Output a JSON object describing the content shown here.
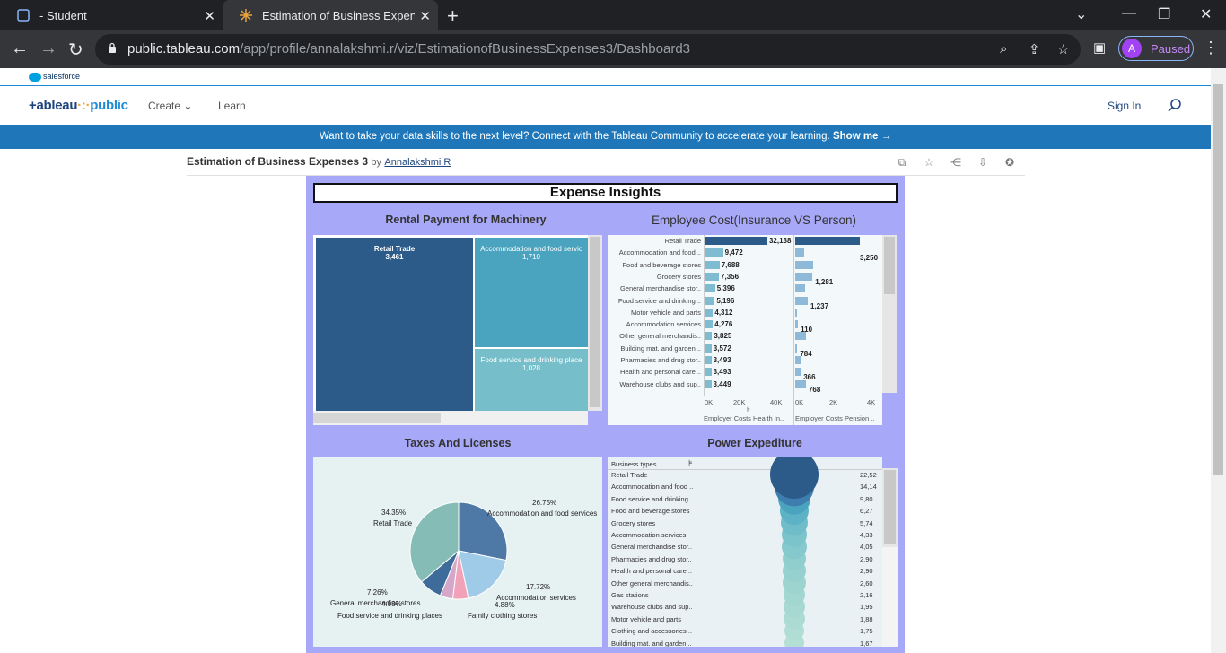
{
  "browser": {
    "tabs": [
      {
        "title": "- Student",
        "active": false
      },
      {
        "title": "Estimation of Business Expenses",
        "active": true
      }
    ],
    "url_host": "public.tableau.com",
    "url_path": "/app/profile/annalakshmi.r/viz/EstimationofBusinessExpenses3/Dashboard3",
    "profile_initial": "A",
    "profile_status": "Paused"
  },
  "salesforce_label": "salesforce",
  "header": {
    "logo_main": "+ableau",
    "logo_sub": "public",
    "nav": [
      "Create",
      "Learn"
    ],
    "signin": "Sign In"
  },
  "banner": {
    "text": "Want to take your data skills to the next level? Connect with the Tableau Community to accelerate your learning.",
    "cta": "Show me →"
  },
  "viz": {
    "title": "Estimation of Business Expenses 3",
    "by": "by",
    "author": "Annalakshmi R"
  },
  "dashboard": {
    "title": "Expense Insights",
    "rental_title": "Rental Payment for Machinery",
    "employee_title": "Employee Cost(Insurance VS Person)",
    "taxes_title": "Taxes And Licenses",
    "power_title": "Power Expediture"
  },
  "treemap": [
    {
      "label": "Retail Trade",
      "value": "3,461",
      "color": "#2c5b8a"
    },
    {
      "label": "Accommodation and food servic",
      "value": "1,710",
      "color": "#4aa4bf"
    },
    {
      "label": "Food service and drinking place",
      "value": "1,028",
      "color": "#76bfca"
    }
  ],
  "employee_chart": {
    "categories": [
      "Retail Trade",
      "Accommodation and food ..",
      "Food and beverage stores",
      "Grocery stores",
      "General merchandise stor..",
      "Food service and drinking ..",
      "Motor vehicle and parts",
      "Accommodation services",
      "Other general merchandis..",
      "Building mat. and garden ..",
      "Pharmacies and drug stor..",
      "Health and personal care ..",
      "Warehouse clubs and sup.."
    ],
    "health_values": [
      32138,
      9472,
      7688,
      7356,
      5396,
      5196,
      4312,
      4276,
      3825,
      3572,
      3493,
      3493,
      3449
    ],
    "health_labels": [
      "32,138",
      "9,472",
      "7,688",
      "7,356",
      "5,396",
      "5,196",
      "4,312",
      "4,276",
      "3,825",
      "3,572",
      "3,493",
      "3,493",
      "3,449"
    ],
    "pension_values": [
      4600,
      650,
      1281,
      1237,
      700,
      900,
      110,
      200,
      784,
      150,
      366,
      400,
      768
    ],
    "pension_labels": [
      "",
      "3,250",
      "",
      "1,281",
      "",
      "1,237",
      "",
      "110",
      "",
      "784",
      "",
      "366",
      "768"
    ],
    "health_ticks": [
      "0K",
      "20K",
      "40K"
    ],
    "pension_ticks": [
      "0K",
      "2K",
      "4K"
    ],
    "health_axis": "Employer Costs Health In..",
    "pension_axis": "Employer Costs Pension ..",
    "health_color": "#2c5b8a",
    "light_color": "#7fbcd2"
  },
  "pie": {
    "slices": [
      {
        "label": "Accommodation and food services",
        "pct": "26.75%",
        "value": 26.75,
        "color": "#4e79a7"
      },
      {
        "label": "Accommodation services",
        "pct": "17.72%",
        "value": 17.72,
        "color": "#a0cbe8"
      },
      {
        "label": "Family clothing stores",
        "pct": "4.88%",
        "value": 4.88,
        "color": "#f1a2b9"
      },
      {
        "label": "Food service and drinking places",
        "pct": "4.08%",
        "value": 4.08,
        "color": "#d4a6c8"
      },
      {
        "label": "General merchandise stores",
        "pct": "7.26%",
        "value": 7.26,
        "color": "#3d6b9a"
      },
      {
        "label": "Retail Trade",
        "pct": "34.35%",
        "value": 34.35,
        "color": "#86bcb6"
      }
    ]
  },
  "power": {
    "header": "Business types",
    "rows": [
      {
        "name": "Retail Trade",
        "value": "22,52"
      },
      {
        "name": "Accommodation and food ..",
        "value": "14,14"
      },
      {
        "name": "Food service and drinking ..",
        "value": "9,80"
      },
      {
        "name": "Food and beverage stores",
        "value": "6,27"
      },
      {
        "name": "Grocery stores",
        "value": "5,74"
      },
      {
        "name": "Accommodation services",
        "value": "4,33"
      },
      {
        "name": "General merchandise stor..",
        "value": "4,05"
      },
      {
        "name": "Pharmacies and drug stor..",
        "value": "2,90"
      },
      {
        "name": "Health and personal care ..",
        "value": "2,90"
      },
      {
        "name": "Other general merchandis..",
        "value": "2,60"
      },
      {
        "name": "Gas stations",
        "value": "2,16"
      },
      {
        "name": "Warehouse clubs and sup..",
        "value": "1,95"
      },
      {
        "name": "Motor vehicle and parts",
        "value": "1,88"
      },
      {
        "name": "Clothing and accessories ..",
        "value": "1,75"
      },
      {
        "name": "Building mat. and garden ..",
        "value": "1,67"
      }
    ]
  }
}
